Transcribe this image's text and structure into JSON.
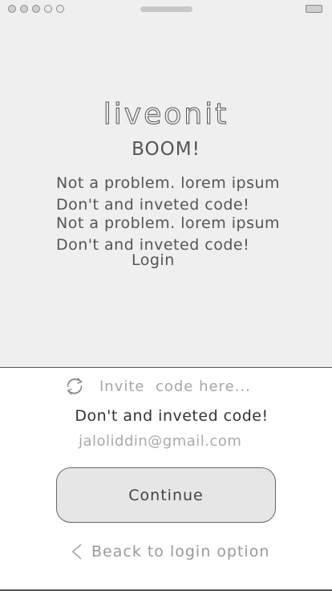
{
  "app": {
    "logo_text": "liveonit",
    "heading": "BOOM!"
  },
  "messages": [
    "Not a problem. lorem ipsum",
    "Don't and inveted code!",
    "Not a problem. lorem ipsum",
    "Don't and inveted code!"
  ],
  "login_link": "Login",
  "invite": {
    "icon": "refresh-icon",
    "placeholder": "Invite  code here..."
  },
  "hint": "Don't and inveted code!",
  "email": "jaloliddin@gmail.com",
  "continue_label": "Continue",
  "back_label": "Beack to login option",
  "colors": {
    "top_background": "#efefef",
    "button_background": "#e6e6e6",
    "text": "#555555",
    "muted_text": "#999999"
  }
}
